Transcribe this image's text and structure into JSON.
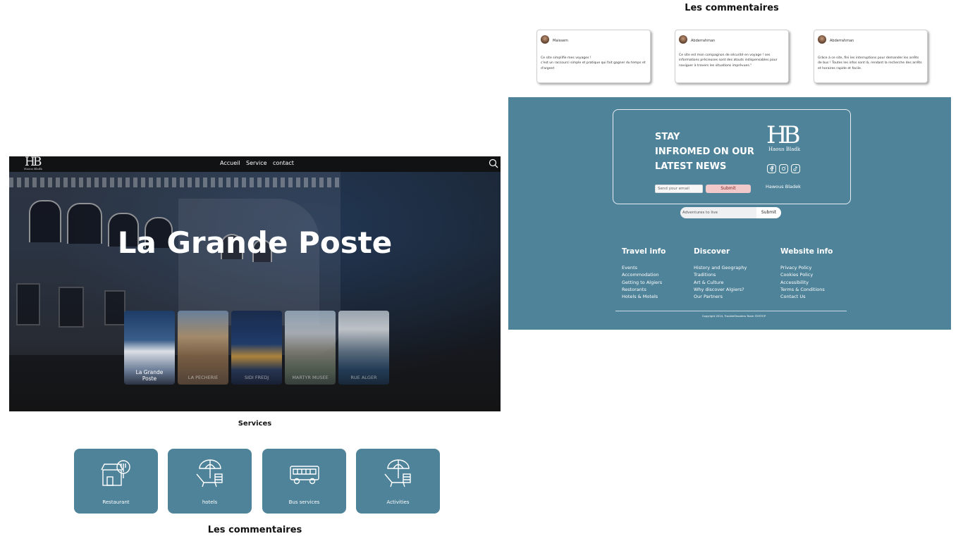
{
  "nav": {
    "logo": "HB",
    "logo_sub": "Haous Bladk",
    "links": [
      "Accueil",
      "Service",
      "contact"
    ]
  },
  "hero": {
    "title": "La Grande Poste",
    "cards": [
      {
        "label": "La Grande\nPoste",
        "active": true
      },
      {
        "label": "LA PECHERIE",
        "active": false
      },
      {
        "label": "SIDI FREDJ",
        "active": false
      },
      {
        "label": "MARTYR MUSEE",
        "active": false
      },
      {
        "label": "RUE ALGER",
        "active": false
      }
    ]
  },
  "services": {
    "heading": "Services",
    "items": [
      {
        "label": "Restaurant",
        "icon": "restaurant-icon"
      },
      {
        "label": "hotels",
        "icon": "beach-umbrella-icon"
      },
      {
        "label": "Bus services",
        "icon": "bus-icon"
      },
      {
        "label": "Activities",
        "icon": "beach-umbrella-icon"
      }
    ]
  },
  "comments": {
    "heading": "Les commentaires",
    "items": [
      {
        "name": "Maissem",
        "text": "Ce site simplifie mes voyages !\nc'est un raccourci simple et pratique qui fait gagner du temps et d'argent"
      },
      {
        "name": "Abderrahman",
        "text": "Ce site est mon compagnon de sécurité en voyage ! ses informations précieuses sont des atouts indispensables pour naviguer à travers les situations imprévues.\""
      },
      {
        "name": "Abderrahman",
        "text": "Grâce à ce site, fini les interruptions pour demander les arrêts de bus ! Toutes les infos sont là, rendant la recherche des arrêts et horaires rapide et facile."
      }
    ]
  },
  "newsletter": {
    "title_lines": [
      "STAY",
      "INFROMED ON OUR",
      "LATEST NEWS"
    ],
    "email_placeholder": "Send your email",
    "submit_label": "Submit",
    "logo": "HB",
    "logo_sub": "Haous Bladk",
    "brand_name": "Hawous Bladek",
    "social_icons": [
      "facebook-icon",
      "instagram-icon",
      "tiktok-icon"
    ]
  },
  "search_bar": {
    "placeholder": "Adventures to live",
    "submit_label": "Submit"
  },
  "footer": {
    "columns": [
      {
        "heading": "Travel info",
        "links": [
          "Events",
          "Accommodation",
          "Getting to Algiers",
          "Restorants",
          "Hotels & Motels"
        ]
      },
      {
        "heading": "Discover",
        "links": [
          "History and Geography",
          "Traditions",
          "Art & Culture",
          "Why discover Algiers?",
          "Our Partners"
        ]
      },
      {
        "heading": "Website info",
        "links": [
          "Privacy Policy",
          "Cookies Policy",
          "Accessibility",
          "Terms & Conditions",
          "Contact Us"
        ]
      }
    ],
    "copyright": "Copyright 2024, TroubleShooters Team ©ESTCP"
  },
  "colors": {
    "accent": "#4f8399",
    "nav_bg": "#101214",
    "submit_pink": "#f1c9cb"
  }
}
